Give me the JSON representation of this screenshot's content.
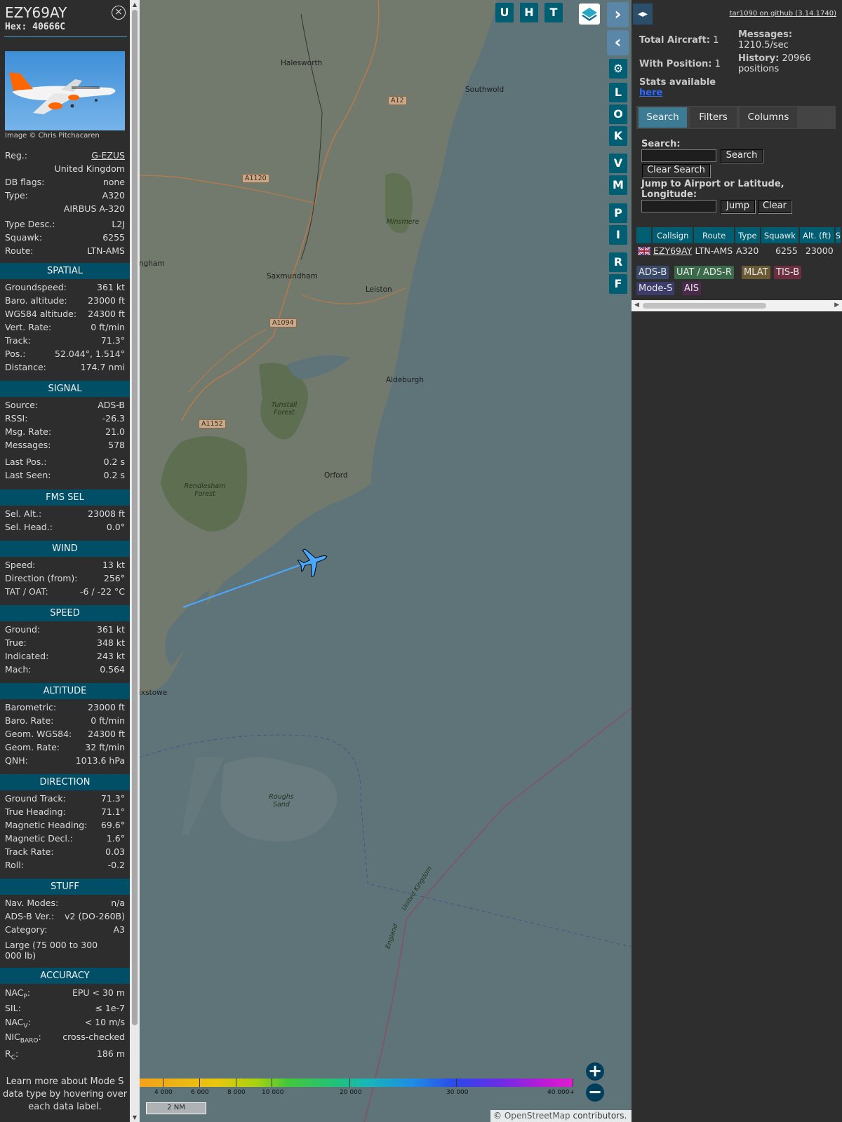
{
  "aircraft": {
    "callsign": "EZY69AY",
    "hex": "Hex: 40666C",
    "close_label": "⊗",
    "photo_credit": "Image © Chris Pitchacaren",
    "rows_top": [
      {
        "k": "Reg.:",
        "v": "G-EZUS"
      },
      {
        "k": "",
        "v": "United Kingdom"
      },
      {
        "k": "DB flags:",
        "v": "none"
      },
      {
        "k": "Type:",
        "v": "A320"
      },
      {
        "k": "",
        "v": "AIRBUS A-320"
      },
      {
        "k": "Type Desc.:",
        "v": "L2J"
      },
      {
        "k": "Squawk:",
        "v": "6255"
      },
      {
        "k": "Route:",
        "v": "LTN-AMS"
      }
    ]
  },
  "sections": {
    "spatial": {
      "title": "SPATIAL",
      "rows": [
        {
          "k": "Groundspeed:",
          "v": "361 kt"
        },
        {
          "k": "Baro. altitude:",
          "v": "23000 ft"
        },
        {
          "k": "WGS84 altitude:",
          "v": "24300 ft"
        },
        {
          "k": "Vert. Rate:",
          "v": "0 ft/min"
        },
        {
          "k": "Track:",
          "v": "71.3°"
        },
        {
          "k": "Pos.:",
          "v": "52.044°, 1.514°"
        },
        {
          "k": "Distance:",
          "v": "174.7 nmi"
        }
      ]
    },
    "signal": {
      "title": "SIGNAL",
      "rows": [
        {
          "k": "Source:",
          "v": "ADS-B"
        },
        {
          "k": "RSSI:",
          "v": "-26.3"
        },
        {
          "k": "Msg. Rate:",
          "v": "21.0"
        },
        {
          "k": "Messages:",
          "v": "578"
        },
        {
          "k": "Last Pos.:",
          "v": "0.2 s"
        },
        {
          "k": "Last Seen:",
          "v": "0.2 s"
        }
      ]
    },
    "fms": {
      "title": "FMS SEL",
      "rows": [
        {
          "k": "Sel. Alt.:",
          "v": "23008 ft"
        },
        {
          "k": "Sel. Head.:",
          "v": "0.0°"
        }
      ]
    },
    "wind": {
      "title": "WIND",
      "rows": [
        {
          "k": "Speed:",
          "v": "13 kt"
        },
        {
          "k": "Direction (from):",
          "v": "256°"
        },
        {
          "k": "TAT / OAT:",
          "v": "-6 / -22 °C"
        }
      ]
    },
    "speed": {
      "title": "SPEED",
      "rows": [
        {
          "k": "Ground:",
          "v": "361 kt"
        },
        {
          "k": "True:",
          "v": "348 kt"
        },
        {
          "k": "Indicated:",
          "v": "243 kt"
        },
        {
          "k": "Mach:",
          "v": "0.564"
        }
      ]
    },
    "altitude": {
      "title": "ALTITUDE",
      "rows": [
        {
          "k": "Barometric:",
          "v": "23000 ft"
        },
        {
          "k": "Baro. Rate:",
          "v": "0 ft/min"
        },
        {
          "k": "Geom. WGS84:",
          "v": "24300 ft"
        },
        {
          "k": "Geom. Rate:",
          "v": "32 ft/min"
        },
        {
          "k": "QNH:",
          "v": "1013.6 hPa"
        }
      ]
    },
    "direction": {
      "title": "DIRECTION",
      "rows": [
        {
          "k": "Ground Track:",
          "v": "71.3°"
        },
        {
          "k": "True Heading:",
          "v": "71.1°"
        },
        {
          "k": "Magnetic Heading:",
          "v": "69.6°"
        },
        {
          "k": "Magnetic Decl.:",
          "v": "1.6°"
        },
        {
          "k": "Track Rate:",
          "v": "0.03"
        },
        {
          "k": "Roll:",
          "v": "-0.2"
        }
      ]
    },
    "stuff": {
      "title": "STUFF",
      "rows": [
        {
          "k": "Nav. Modes:",
          "v": "n/a"
        },
        {
          "k": "ADS-B Ver.:",
          "v": "v2 (DO-260B)"
        },
        {
          "k": "Category:",
          "v": "A3"
        }
      ],
      "category_desc": "Large (75 000 to 300 000 lb)"
    },
    "accuracy": {
      "title": "ACCURACY",
      "nacp_k": "NAC",
      "nacp_sub": "P",
      "nacp_v": "EPU < 30 m",
      "sil_k": "SIL:",
      "sil_v": "≤ 1e-7",
      "nacv_k": "NAC",
      "nacv_sub": "V",
      "nacv_v": "< 10 m/s",
      "nicbaro_k": "NIC",
      "nicbaro_sub": "BARO",
      "nicbaro_v": "cross-checked",
      "rc_k": "R",
      "rc_sub": "C",
      "rc_v": "186 m"
    },
    "note": "Learn more about Mode S data type by hovering over each data label."
  },
  "map": {
    "places": [
      {
        "name": "Halesworth"
      },
      {
        "name": "Southwold"
      },
      {
        "name": "Saxmundham"
      },
      {
        "name": "Leiston"
      },
      {
        "name": "Aldeburgh"
      },
      {
        "name": "Orford"
      },
      {
        "name": "ngham"
      },
      {
        "name": "ixstowe"
      }
    ],
    "roads": [
      "A12",
      "A1120",
      "A1094",
      "A1152"
    ],
    "forests": [
      "Minsmere",
      "Tunstall Forest",
      "Rendlesham Forest",
      "Roughs Sand"
    ],
    "border_labels": [
      "United Kingdom",
      "England"
    ],
    "buttons": [
      "U",
      "H",
      "T",
      "L",
      "O",
      "K",
      "V",
      "M",
      "P",
      "I",
      "R",
      "F"
    ],
    "nav_next": "›",
    "nav_prev": "‹",
    "zoom_in": "+",
    "zoom_out": "−",
    "scale": "2 NM",
    "attribution_prefix": "© ",
    "attribution_link": "OpenStreetMap",
    "attribution_suffix": " contributors.",
    "altitude_labels": [
      "4 000",
      "6 000",
      "8 000",
      "10 000",
      "20 000",
      "30 000",
      "40 000+"
    ],
    "aircraft_color": "#4aa8ff"
  },
  "right": {
    "split_label": "◂▸",
    "version": "tar1090 on github (3.14.1740)",
    "total_label": "Total Aircraft:",
    "total_value": "1",
    "messages_label": "Messages:",
    "messages_value": "1210.5/sec",
    "withpos_label": "With Position:",
    "withpos_value": "1",
    "history_label": "History:",
    "history_value": "20966 positions",
    "stats_label": "Stats available",
    "stats_link": "here",
    "tabs": [
      "Search",
      "Filters",
      "Columns"
    ],
    "search_label": "Search:",
    "search_button": "Search",
    "clear_search_button": "Clear Search",
    "jump_label": "Jump to Airport or Latitude, Longitude:",
    "jump_button": "Jump",
    "clear_button": "Clear",
    "table": {
      "headers": [
        "",
        "Callsign",
        "Route",
        "Type",
        "Squawk",
        "Alt. (ft)",
        "S"
      ],
      "rows": [
        {
          "callsign": "EZY69AY",
          "route": "LTN-AMS",
          "type": "A320",
          "squawk": "6255",
          "alt": "23000"
        }
      ]
    },
    "legend": [
      {
        "label": "ADS-B",
        "color": "#3a4a6a"
      },
      {
        "label": "UAT / ADS-R",
        "color": "#3a6a4a"
      },
      {
        "label": "MLAT",
        "color": "#6a5a34"
      },
      {
        "label": "TIS-B",
        "color": "#6a3040"
      },
      {
        "label": "Mode-S",
        "color": "#3c3c6a"
      },
      {
        "label": "AIS",
        "color": "#4a2a4a"
      }
    ]
  }
}
